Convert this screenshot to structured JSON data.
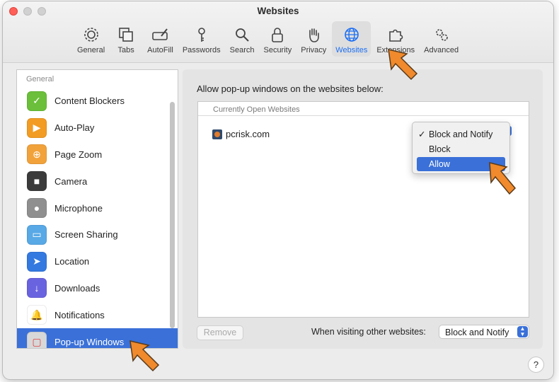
{
  "window": {
    "title": "Websites"
  },
  "toolbar": [
    {
      "label": "General",
      "icon": "gear-icon"
    },
    {
      "label": "Tabs",
      "icon": "tabs-icon"
    },
    {
      "label": "AutoFill",
      "icon": "pencil-field-icon"
    },
    {
      "label": "Passwords",
      "icon": "key-icon"
    },
    {
      "label": "Search",
      "icon": "magnifier-icon"
    },
    {
      "label": "Security",
      "icon": "lock-icon"
    },
    {
      "label": "Privacy",
      "icon": "hand-icon"
    },
    {
      "label": "Websites",
      "icon": "globe-icon",
      "selected": true
    },
    {
      "label": "Extensions",
      "icon": "puzzle-icon"
    },
    {
      "label": "Advanced",
      "icon": "gears-icon"
    }
  ],
  "sidebar": {
    "header": "General",
    "items": [
      {
        "label": "Content Blockers",
        "color": "#6bbf3a"
      },
      {
        "label": "Auto-Play",
        "color": "#f29c24"
      },
      {
        "label": "Page Zoom",
        "color": "#f2a23b"
      },
      {
        "label": "Camera",
        "color": "#3b3b3b"
      },
      {
        "label": "Microphone",
        "color": "#8f8f8f"
      },
      {
        "label": "Screen Sharing",
        "color": "#58a9e6"
      },
      {
        "label": "Location",
        "color": "#3379e0"
      },
      {
        "label": "Downloads",
        "color": "#6a63e0"
      },
      {
        "label": "Notifications",
        "color": "#ffffff"
      },
      {
        "label": "Pop-up Windows",
        "color": "#d8d8d8",
        "selected": true
      }
    ]
  },
  "main": {
    "heading": "Allow pop-up windows on the websites below:",
    "table_header": "Currently Open Websites",
    "site": "pcrisk.com",
    "remove_label": "Remove",
    "other_label": "When visiting other websites:",
    "other_value": "Block and Notify"
  },
  "dropdown": {
    "options": [
      "Block and Notify",
      "Block",
      "Allow"
    ],
    "checked_index": 0,
    "highlighted_index": 2,
    "check": "✓"
  },
  "help": "?",
  "colors": {
    "accent": "#3a70d8",
    "arrow": "#f08a2c"
  }
}
